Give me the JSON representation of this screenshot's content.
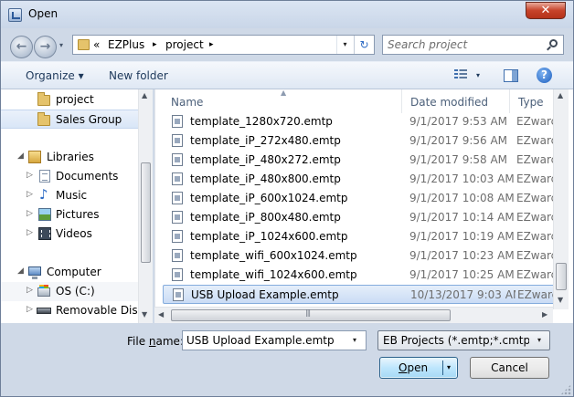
{
  "window": {
    "title": "Open",
    "close_glyph": "✕"
  },
  "nav": {
    "back_glyph": "←",
    "forward_glyph": "→",
    "history_glyph": "▾",
    "address": {
      "prefix": "«",
      "segments": [
        "EZPlus",
        "project"
      ],
      "separator": "▸",
      "dropdown_glyph": "▾",
      "refresh_glyph": "↻"
    },
    "search_placeholder": "Search project"
  },
  "toolbar": {
    "organize": "Organize ▾",
    "new_folder": "New folder",
    "view_dropdown_glyph": "▾",
    "help_glyph": "?"
  },
  "navpane": {
    "items": [
      {
        "label": "project",
        "icon": "folder-icon",
        "expander": "",
        "selected": false
      },
      {
        "label": "Sales Group",
        "icon": "folder-icon",
        "expander": "",
        "selected": true
      },
      {
        "label": "Libraries",
        "icon": "libraries-icon",
        "expander": "◢",
        "selected": false
      },
      {
        "label": "Documents",
        "icon": "documents-icon",
        "expander": "▷",
        "selected": false
      },
      {
        "label": "Music",
        "icon": "music-icon",
        "expander": "▷",
        "selected": false
      },
      {
        "label": "Pictures",
        "icon": "pictures-icon",
        "expander": "▷",
        "selected": false
      },
      {
        "label": "Videos",
        "icon": "videos-icon",
        "expander": "▷",
        "selected": false
      },
      {
        "label": "Computer",
        "icon": "computer-icon",
        "expander": "◢",
        "selected": false
      },
      {
        "label": "OS (C:)",
        "icon": "os-drive-icon",
        "expander": "▷",
        "selected": false
      },
      {
        "label": "Removable Disk (",
        "icon": "removable-disk-icon",
        "expander": "▷",
        "selected": false
      }
    ],
    "scroll_up_glyph": "▲",
    "scroll_down_glyph": "▼"
  },
  "filelist": {
    "columns": {
      "name": "Name",
      "date": "Date modified",
      "type": "Type",
      "sort_glyph": "▲"
    },
    "rows": [
      {
        "name": "template_1280x720.emtp",
        "date": "9/1/2017 9:53 AM",
        "type": "EZwarc"
      },
      {
        "name": "template_iP_272x480.emtp",
        "date": "9/1/2017 9:56 AM",
        "type": "EZwarc"
      },
      {
        "name": "template_iP_480x272.emtp",
        "date": "9/1/2017 9:58 AM",
        "type": "EZwarc"
      },
      {
        "name": "template_iP_480x800.emtp",
        "date": "9/1/2017 10:03 AM",
        "type": "EZwarc"
      },
      {
        "name": "template_iP_600x1024.emtp",
        "date": "9/1/2017 10:08 AM",
        "type": "EZwarc"
      },
      {
        "name": "template_iP_800x480.emtp",
        "date": "9/1/2017 10:14 AM",
        "type": "EZwarc"
      },
      {
        "name": "template_iP_1024x600.emtp",
        "date": "9/1/2017 10:19 AM",
        "type": "EZwarc"
      },
      {
        "name": "template_wifi_600x1024.emtp",
        "date": "9/1/2017 10:23 AM",
        "type": "EZwarc"
      },
      {
        "name": "template_wifi_1024x600.emtp",
        "date": "9/1/2017 10:25 AM",
        "type": "EZwarc"
      },
      {
        "name": "USB Upload Example.emtp",
        "date": "10/13/2017 9:03 AM",
        "type": "EZwarc",
        "selected": true
      }
    ],
    "scroll_up_glyph": "▲",
    "scroll_down_glyph": "▼",
    "scroll_left_glyph": "◀",
    "scroll_right_glyph": "▶"
  },
  "bottom": {
    "file_name_label_start": "File ",
    "file_name_label_underlined": "n",
    "file_name_label_end": "ame:",
    "file_name_value": "USB Upload Example.emtp",
    "file_name_dropdown_glyph": "▾",
    "file_type": "EB Projects (*.emtp;*.cmtp;*.mt",
    "file_type_dropdown_glyph": "▾",
    "open_label_underlined": "O",
    "open_label_rest": "pen",
    "open_dropdown_glyph": "▾",
    "cancel_label": "Cancel"
  }
}
